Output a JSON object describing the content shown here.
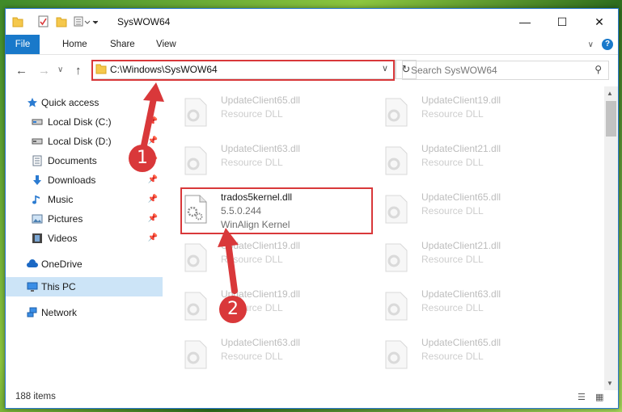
{
  "window": {
    "title": "SysWOW64"
  },
  "ribbon": {
    "tabs": [
      "File",
      "Home",
      "Share",
      "View"
    ]
  },
  "navigation": {
    "address": "C:\\Windows\\SysWOW64",
    "search_placeholder": "Search SysWOW64"
  },
  "sidebar": {
    "items": [
      {
        "label": "Quick access",
        "icon": "star-icon"
      },
      {
        "label": "Local Disk (C:)",
        "icon": "drive-icon",
        "pinned": true
      },
      {
        "label": "Local Disk (D:)",
        "icon": "drive-icon",
        "pinned": true
      },
      {
        "label": "Documents",
        "icon": "documents-icon",
        "pinned": true
      },
      {
        "label": "Downloads",
        "icon": "download-icon",
        "pinned": true
      },
      {
        "label": "Music",
        "icon": "music-icon",
        "pinned": true
      },
      {
        "label": "Pictures",
        "icon": "pictures-icon",
        "pinned": true
      },
      {
        "label": "Videos",
        "icon": "videos-icon",
        "pinned": true
      },
      {
        "label": "OneDrive",
        "icon": "cloud-icon"
      },
      {
        "label": "This PC",
        "icon": "computer-icon",
        "selected": true
      },
      {
        "label": "Network",
        "icon": "network-icon"
      }
    ]
  },
  "files": {
    "left": [
      {
        "name": "UpdateClient65.dll",
        "desc": "Resource DLL"
      },
      {
        "name": "UpdateClient63.dll",
        "desc": "Resource DLL"
      },
      {
        "name": "trados5kernel.dll",
        "version": "5.5.0.244",
        "desc": "WinAlign Kernel",
        "active": true
      },
      {
        "name": "UpdateClient19.dll",
        "desc": "Resource DLL"
      },
      {
        "name": "UpdateClient19.dll",
        "desc": "Resource DLL"
      },
      {
        "name": "UpdateClient63.dll",
        "desc": "Resource DLL"
      }
    ],
    "right": [
      {
        "name": "UpdateClient19.dll",
        "desc": "Resource DLL"
      },
      {
        "name": "UpdateClient21.dll",
        "desc": "Resource DLL"
      },
      {
        "name": "UpdateClient65.dll",
        "desc": "Resource DLL"
      },
      {
        "name": "UpdateClient21.dll",
        "desc": "Resource DLL"
      },
      {
        "name": "UpdateClient63.dll",
        "desc": "Resource DLL"
      },
      {
        "name": "UpdateClient65.dll",
        "desc": "Resource DLL"
      }
    ]
  },
  "status": {
    "count": "188 items"
  },
  "annotations": {
    "step1": "1",
    "step2": "2",
    "color": "#d9383a"
  }
}
